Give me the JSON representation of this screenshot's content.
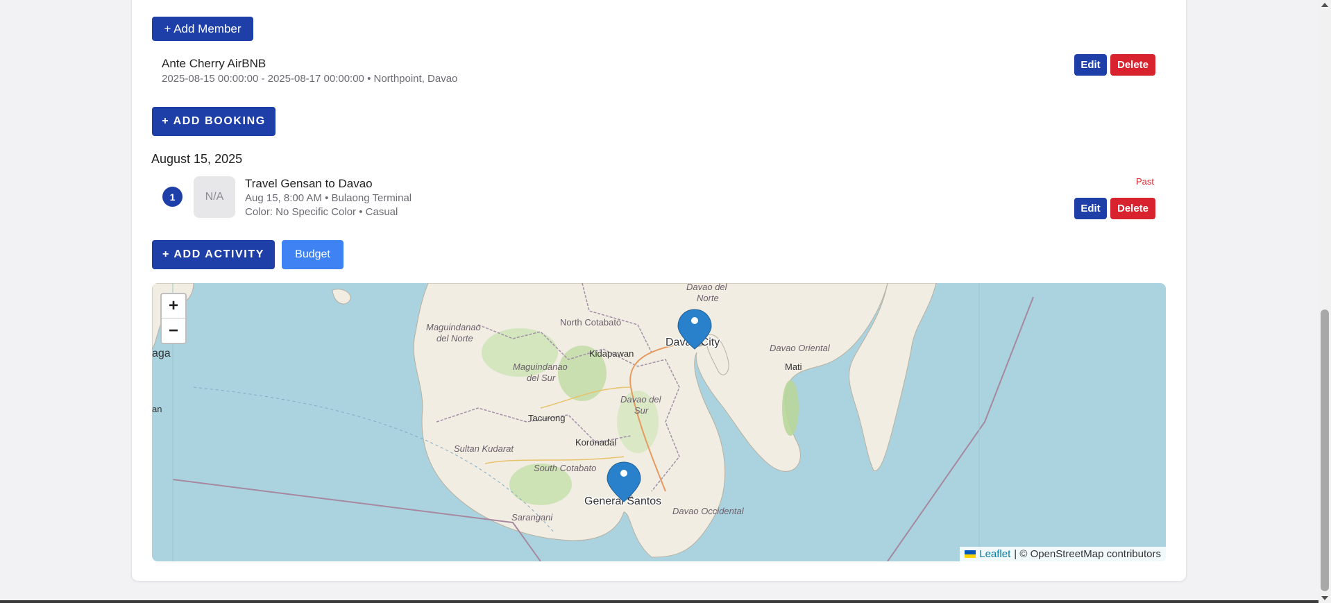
{
  "members": {
    "add_label": "+ Add Member"
  },
  "booking": {
    "name": "Ante Cherry AirBNB",
    "meta": "2025-08-15 00:00:00 - 2025-08-17 00:00:00 • Northpoint, Davao",
    "edit_label": "Edit",
    "delete_label": "Delete",
    "add_label": "+ Add Booking"
  },
  "itinerary": {
    "date": "August 15, 2025",
    "activities": [
      {
        "number": "1",
        "thumb": "N/A",
        "title": "Travel Gensan to Davao",
        "line1": "Aug 15, 8:00 AM • Bulaong Terminal",
        "line2": "Color: No Specific Color • Casual",
        "status": "Past",
        "edit_label": "Edit",
        "delete_label": "Delete"
      }
    ],
    "add_activity_label": "+ Add Activity",
    "budget_label": "Budget"
  },
  "map": {
    "zoom_in": "+",
    "zoom_out": "−",
    "labels": {
      "davao_del_norte": "Davao del",
      "davao_del_norte2": "Norte",
      "maguindanao_norte": "Maguindanao",
      "maguindanao_norte2": "del Norte",
      "north_cotabato": "North Cotabato",
      "davao_city": "Davao City",
      "kidapawan": "Kidapawan",
      "davao_oriental": "Davao Oriental",
      "maguindanao_sur": "Maguindanao",
      "maguindanao_sur2": "del Sur",
      "mati": "Mati",
      "davao_del_sur": "Davao del",
      "davao_del_sur2": "Sur",
      "tacurong": "Tacurong",
      "koronadal": "Koronadal",
      "sultan_kudarat": "Sultan Kudarat",
      "south_cotabato": "South Cotabato",
      "general_santos": "General Santos",
      "sarangani": "Sarangani",
      "davao_occidental": "Davao Occidental",
      "edge_aga": "aga",
      "edge_an": "an"
    },
    "markers": [
      "davao-city",
      "general-santos"
    ],
    "attribution": {
      "link": "Leaflet",
      "text": "| © OpenStreetMap contributors"
    }
  },
  "colors": {
    "primary": "#1f3fa8",
    "danger": "#d8222d",
    "budget": "#3e82f3",
    "sea": "#aad3df",
    "marker": "#2a81cb"
  }
}
